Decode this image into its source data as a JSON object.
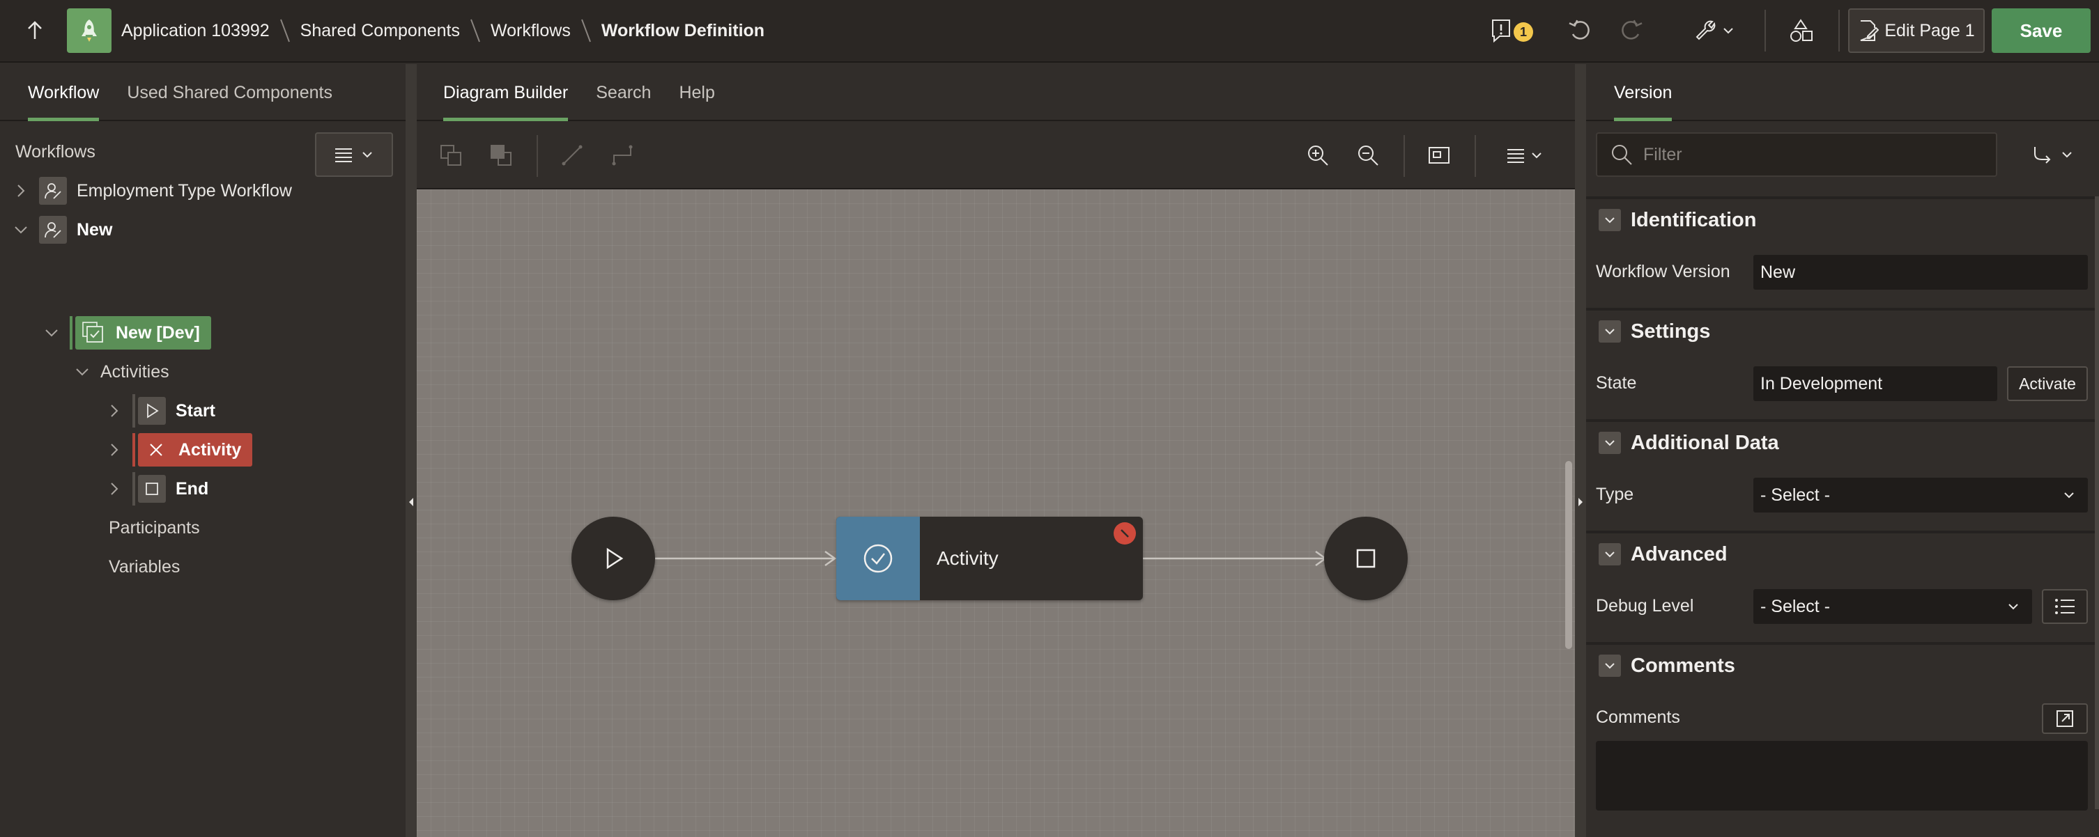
{
  "header": {
    "breadcrumbs": [
      "Application 103992",
      "Shared Components",
      "Workflows",
      "Workflow Definition"
    ],
    "notification_count": "1",
    "edit_page_label": "Edit Page 1",
    "save_label": "Save",
    "accent_color": "#6aa263"
  },
  "left_panel": {
    "tabs": [
      "Workflow",
      "Used Shared Components"
    ],
    "section_label": "Workflows",
    "tree": {
      "workflow_1": "Employment Type Workflow",
      "workflow_2": "New",
      "version": "New [Dev]",
      "activities": "Activities",
      "start": "Start",
      "activity": "Activity",
      "end": "End",
      "participants": "Participants",
      "variables": "Variables"
    }
  },
  "center_panel": {
    "tabs": [
      "Diagram Builder",
      "Search",
      "Help"
    ],
    "diagram": {
      "activity_label": "Activity",
      "activity_color": "#4e7c9b",
      "error_color": "#cf4a3c"
    }
  },
  "right_panel": {
    "tab": "Version",
    "filter_placeholder": "Filter",
    "sections": {
      "identification": "Identification",
      "settings": "Settings",
      "additional_data": "Additional Data",
      "advanced": "Advanced",
      "comments": "Comments"
    },
    "fields": {
      "workflow_version_label": "Workflow Version",
      "workflow_version_value": "New",
      "state_label": "State",
      "state_value": "In Development",
      "activate_label": "Activate",
      "type_label": "Type",
      "type_value": "- Select -",
      "debug_level_label": "Debug Level",
      "debug_level_value": "- Select -",
      "comments_label": "Comments"
    }
  }
}
